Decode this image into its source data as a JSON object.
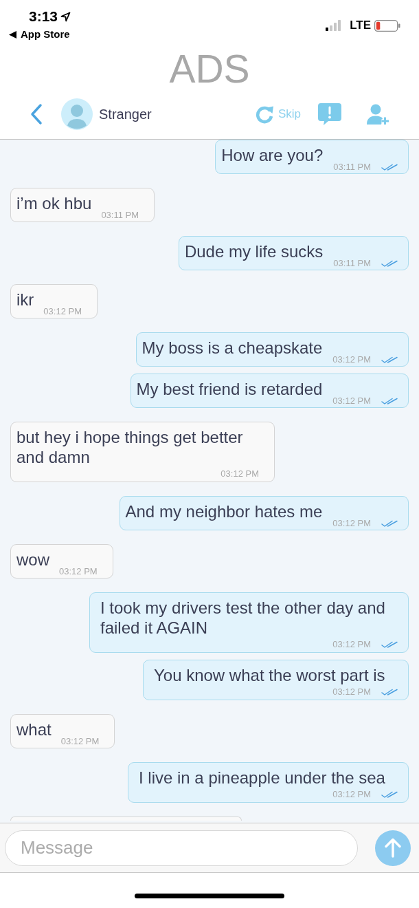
{
  "status_bar": {
    "time": "3:13",
    "back_label": "App Store",
    "network": "LTE"
  },
  "banner": {
    "text": "ADS"
  },
  "header": {
    "contact_name": "Stranger",
    "skip_label": "Skip"
  },
  "messages": [
    {
      "kind": "sent",
      "text": "How are you?",
      "time": "03:11 PM",
      "read": true
    },
    {
      "kind": "received",
      "text": "i’m ok hbu",
      "time": "03:11 PM"
    },
    {
      "kind": "sent",
      "text": "Dude my life sucks",
      "time": "03:11 PM",
      "read": true
    },
    {
      "kind": "received",
      "text": "ikr",
      "time": "03:12 PM"
    },
    {
      "kind": "sent",
      "text": "My boss is a cheapskate",
      "time": "03:12 PM",
      "read": true
    },
    {
      "kind": "sent",
      "text": "My best friend is retarded",
      "time": "03:12 PM",
      "read": true
    },
    {
      "kind": "received",
      "text": "but hey i hope things get better and damn",
      "time": "03:12 PM"
    },
    {
      "kind": "sent",
      "text": "And my neighbor hates me",
      "time": "03:12 PM",
      "read": true
    },
    {
      "kind": "received",
      "text": "wow",
      "time": "03:12 PM"
    },
    {
      "kind": "sent",
      "text": "I took my drivers test the other day and failed it AGAIN",
      "time": "03:12 PM",
      "read": true
    },
    {
      "kind": "sent",
      "text": "You know what the worst part is",
      "time": "03:12 PM",
      "read": true
    },
    {
      "kind": "received",
      "text": "what",
      "time": "03:12 PM"
    },
    {
      "kind": "sent",
      "text": "I live in a pineapple under the sea",
      "time": "03:12 PM",
      "read": true
    },
    {
      "kind": "received"
    }
  ],
  "composer": {
    "placeholder": "Message"
  }
}
